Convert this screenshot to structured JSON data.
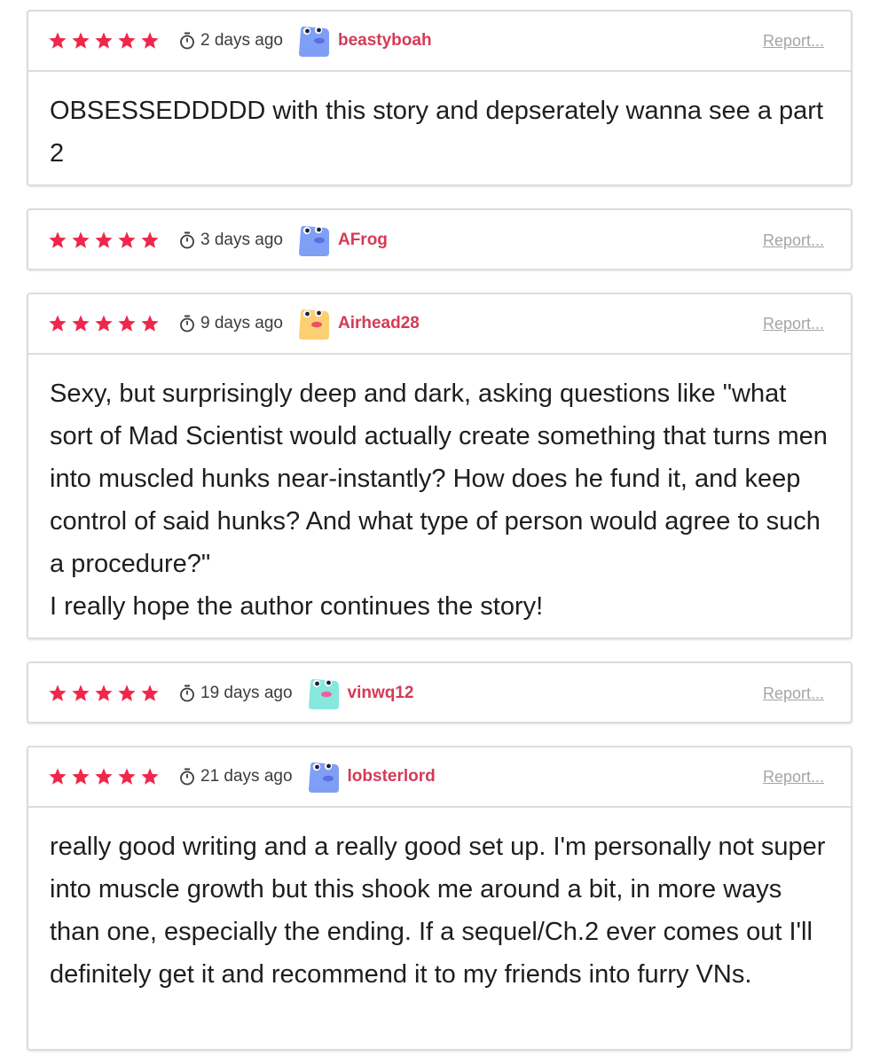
{
  "colors": {
    "star": "#f0264b",
    "username": "#d63a55",
    "report": "#a5a5a5",
    "border": "#dcdcdc"
  },
  "reviews": [
    {
      "rating": 5,
      "time": "2 days ago",
      "username": "beastyboah",
      "avatar_color": "#7f9ff5",
      "report_label": "Report...",
      "body": "OBSESSEDDDDD with this story and depserately wanna see a part 2"
    },
    {
      "rating": 5,
      "time": "3 days ago",
      "username": "AFrog",
      "avatar_color": "#7f9ff5",
      "report_label": "Report...",
      "body": ""
    },
    {
      "rating": 5,
      "time": "9 days ago",
      "username": "Airhead28",
      "avatar_color": "#fcd072",
      "report_label": "Report...",
      "body": "Sexy, but surprisingly deep and dark, asking questions like \"what sort of Mad Scientist would actually create something that turns men into muscled hunks near-instantly? How does he fund it, and keep control of said hunks? And what type of person would agree to such a procedure?\"\nI really hope the author continues the story!"
    },
    {
      "rating": 5,
      "time": "19 days ago",
      "username": "vinwq12",
      "avatar_color": "#86e8dc",
      "report_label": "Report...",
      "body": ""
    },
    {
      "rating": 5,
      "time": "21 days ago",
      "username": "lobsterlord",
      "avatar_color": "#7f9ff5",
      "report_label": "Report...",
      "body": "really good writing and a really good set up. I'm personally not super into muscle growth but this shook me around a bit, in more ways than one, especially the ending. If a sequel/Ch.2 ever comes out I'll definitely get it and recommend it to my friends into furry VNs."
    }
  ]
}
